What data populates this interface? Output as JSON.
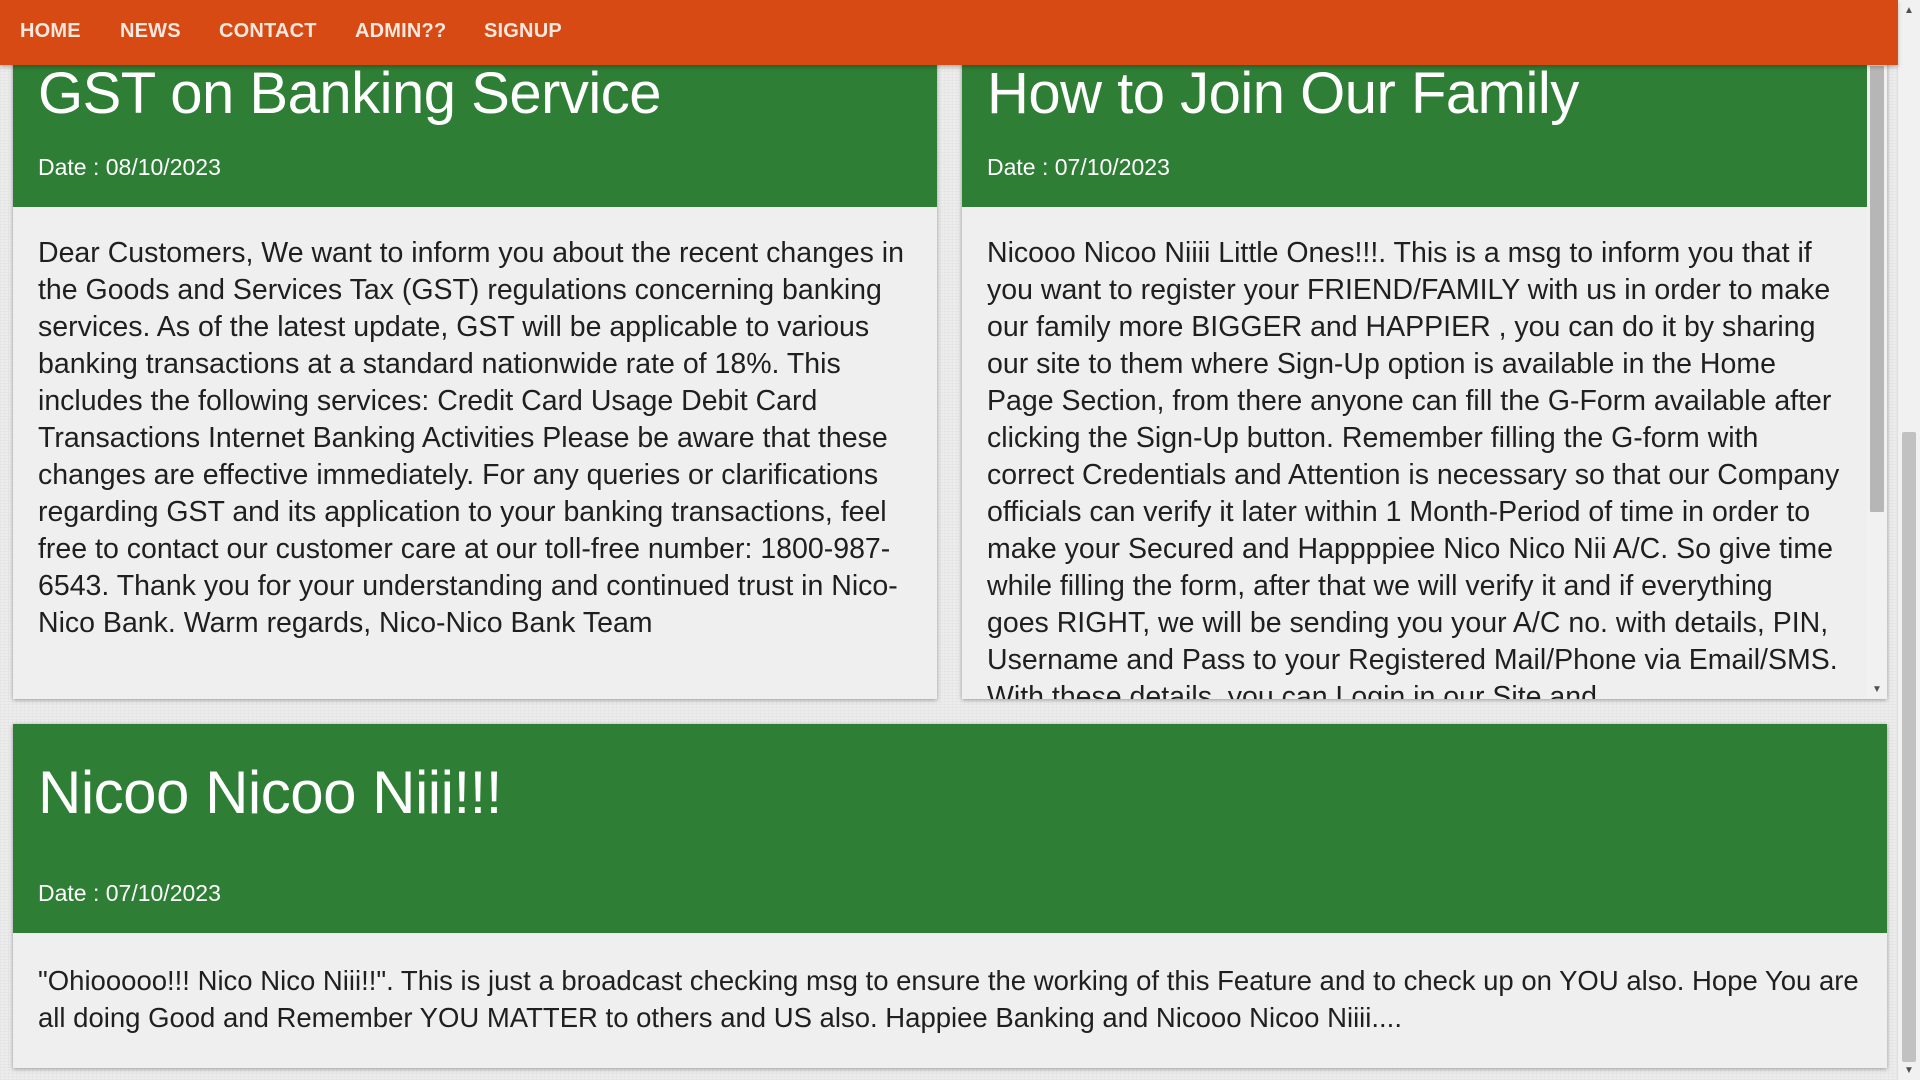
{
  "nav": {
    "items": [
      "HOME",
      "NEWS",
      "CONTACT",
      "ADMIN??",
      "SIGNUP"
    ]
  },
  "news": [
    {
      "title": "GST on Banking Service",
      "date": "Date : 08/10/2023",
      "body": "Dear Customers, We want to inform you about the recent changes in the Goods and Services Tax (GST) regulations concerning banking services. As of the latest update, GST will be applicable to various banking transactions at a standard nationwide rate of 18%. This includes the following services: Credit Card Usage Debit Card Transactions Internet Banking Activities Please be aware that these changes are effective immediately. For any queries or clarifications regarding GST and its application to your banking transactions, feel free to contact our customer care at our toll-free number: 1800-987-6543. Thank you for your understanding and continued trust in Nico-Nico Bank. Warm regards, Nico-Nico Bank Team"
    },
    {
      "title": "How to Join Our Family",
      "date": "Date : 07/10/2023",
      "body": "Nicooo Nicoo Niiii Little Ones!!!. This is a msg to inform you that if you want to register your FRIEND/FAMILY with us in order to make our family more BIGGER and HAPPIER , you can do it by sharing our site to them where Sign-Up option is available in the Home Page Section, from there anyone can fill the G-Form available after clicking the Sign-Up button. Remember filling the G-form with correct Credentials and Attention is necessary so that our Company officials can verify it later within 1 Month-Period of time in order to make your Secured and Happppiee Nico Nico Nii A/C. So give time while filling the form, after that we will verify it and if everything goes RIGHT, we will be sending you your A/C no. with details, PIN, Username and Pass to your Registered Mail/Phone via Email/SMS. With these details, you can Login in our Site and"
    },
    {
      "title": "Nicoo Nicoo Niii!!!",
      "date": "Date : 07/10/2023",
      "body": "\"Ohiooooo!!! Nico Nico Niii!!\". This is just a broadcast checking msg to ensure the working of this Feature and to check up on YOU also. Hope You are all doing Good and Remember YOU MATTER to others and US also. Happiee Banking and Nicooo Nicoo Niiii...."
    }
  ],
  "colors": {
    "nav_bg": "#d84a14",
    "card_header_bg": "#2f7e35",
    "card_body_bg": "#efefef"
  },
  "icons": {
    "scroll_up": "chevron-up-icon",
    "scroll_down": "chevron-down-icon"
  }
}
